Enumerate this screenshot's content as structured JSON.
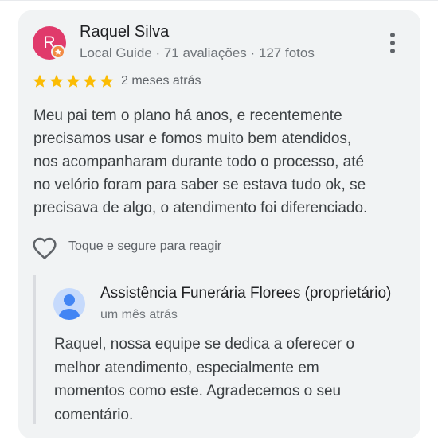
{
  "review": {
    "avatar_letter": "R",
    "avatar_color": "#e03a6b",
    "badge_icon": "local-guide-star-icon",
    "badge_color": "#f28b44",
    "author": "Raquel Silva",
    "author_meta": "Local Guide · 71 avaliações · 127 fotos",
    "rating": 5,
    "rating_max": 5,
    "star_color": "#fbbc04",
    "date": "2 meses atrás",
    "text": "Meu pai tem o plano há anos, e recentemente\nprecisamos usar e fomos muito bem atendidos,\nnos acompanharam durante todo o processo, até\nno velório foram para saber se estava tudo ok, se\nprecisava de algo, o atendimento foi diferenciado.",
    "menu_icon": "more-vert-icon",
    "react_icon": "heart-outline-icon",
    "react_hint": "Toque e segure para reagir"
  },
  "reply": {
    "avatar_icon": "default-person-avatar-icon",
    "owner": "Assistência Funerária Florees (proprietário)",
    "date": "um mês atrás",
    "text": "Raquel, nossa equipe se dedica a oferecer o\nmelhor atendimento, especialmente em\nmomentos como este. Agradecemos o seu\ncomentário."
  }
}
